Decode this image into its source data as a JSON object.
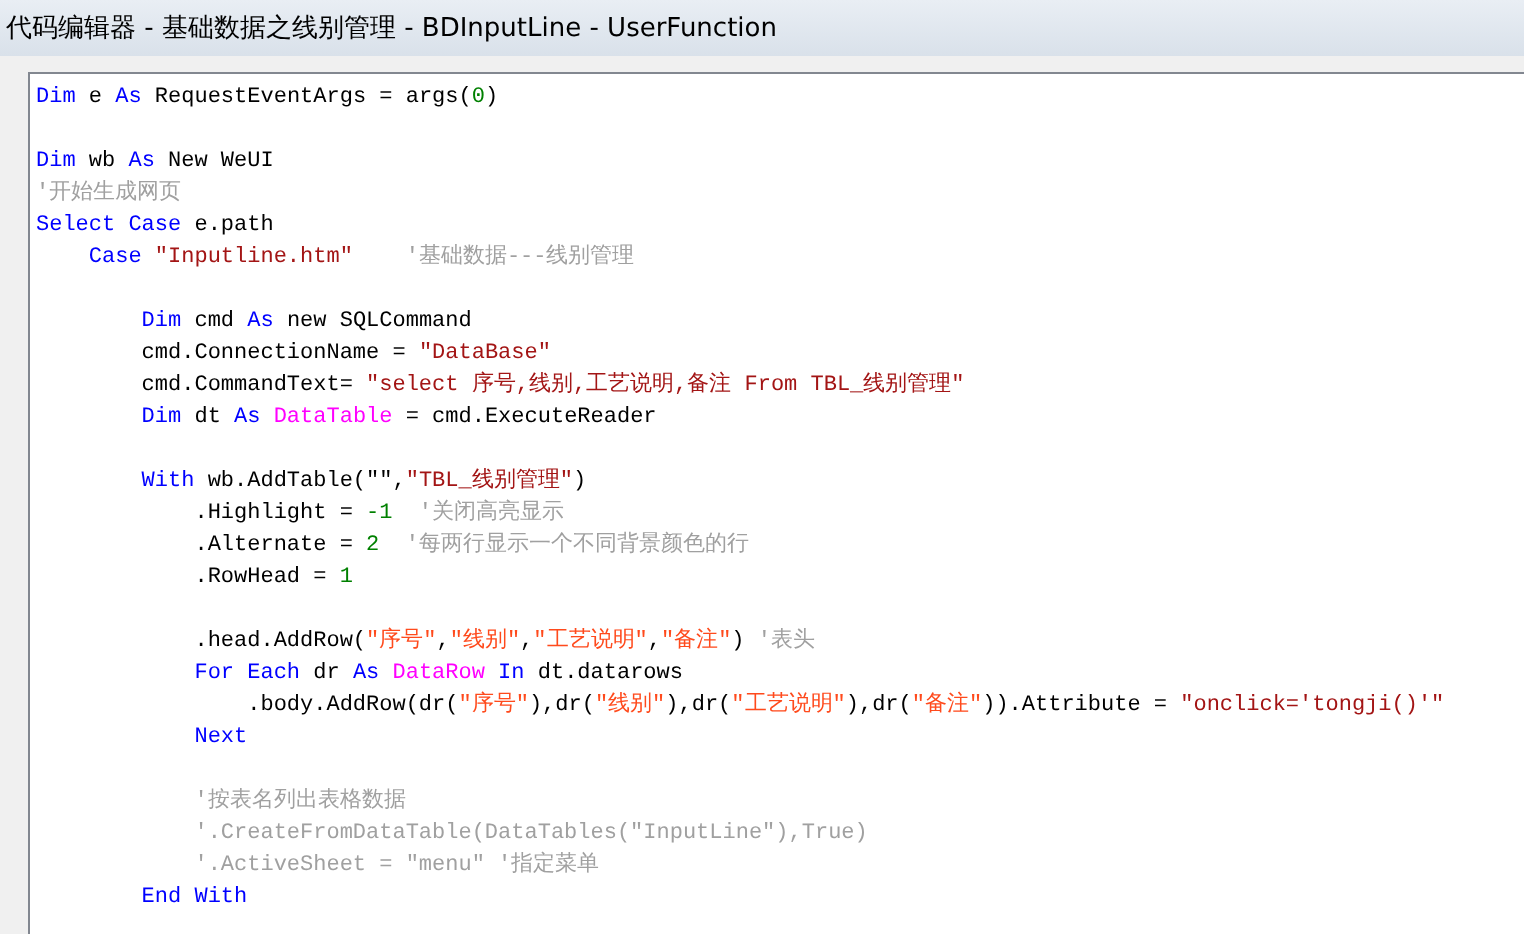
{
  "window": {
    "title": "代码编辑器 - 基础数据之线别管理 - BDInputLine - UserFunction"
  },
  "editor": {
    "lines": [
      {
        "kind": "code",
        "tokens": [
          {
            "kind": "keyword",
            "text": "Dim"
          },
          {
            "kind": "plain",
            "text": " e "
          },
          {
            "kind": "keyword",
            "text": "As"
          },
          {
            "kind": "plain",
            "text": " RequestEventArgs = args("
          },
          {
            "kind": "number",
            "text": "0"
          },
          {
            "kind": "plain",
            "text": ")"
          }
        ]
      },
      {
        "kind": "blank"
      },
      {
        "kind": "code",
        "tokens": [
          {
            "kind": "keyword",
            "text": "Dim"
          },
          {
            "kind": "plain",
            "text": " wb "
          },
          {
            "kind": "keyword",
            "text": "As"
          },
          {
            "kind": "plain",
            "text": " New WeUI"
          }
        ]
      },
      {
        "kind": "code",
        "tokens": [
          {
            "kind": "comment",
            "text": "'开始生成网页"
          }
        ]
      },
      {
        "kind": "code",
        "tokens": [
          {
            "kind": "keyword",
            "text": "Select Case"
          },
          {
            "kind": "plain",
            "text": " e.path"
          }
        ]
      },
      {
        "kind": "code",
        "tokens": [
          {
            "kind": "keyword",
            "text": "    Case"
          },
          {
            "kind": "string",
            "text": " \"Inputline.htm\""
          },
          {
            "kind": "comment",
            "text": "    '基础数据---线别管理"
          }
        ]
      },
      {
        "kind": "blank"
      },
      {
        "kind": "code",
        "tokens": [
          {
            "kind": "keyword",
            "text": "        Dim"
          },
          {
            "kind": "plain",
            "text": " cmd "
          },
          {
            "kind": "keyword",
            "text": "As"
          },
          {
            "kind": "plain",
            "text": " new SQLCommand"
          }
        ]
      },
      {
        "kind": "code",
        "tokens": [
          {
            "kind": "plain",
            "text": "        cmd.ConnectionName = "
          },
          {
            "kind": "string",
            "text": "\"DataBase\""
          }
        ]
      },
      {
        "kind": "code",
        "tokens": [
          {
            "kind": "plain",
            "text": "        cmd.CommandText= "
          },
          {
            "kind": "string",
            "text": "\"select 序号,线别,工艺说明,备注 From TBL_线别管理\""
          }
        ]
      },
      {
        "kind": "code",
        "tokens": [
          {
            "kind": "keyword",
            "text": "        Dim"
          },
          {
            "kind": "plain",
            "text": " dt "
          },
          {
            "kind": "keyword",
            "text": "As"
          },
          {
            "kind": "type",
            "text": " DataTable"
          },
          {
            "kind": "plain",
            "text": " = cmd.ExecuteReader"
          }
        ]
      },
      {
        "kind": "blank"
      },
      {
        "kind": "code",
        "tokens": [
          {
            "kind": "keyword",
            "text": "        With"
          },
          {
            "kind": "plain",
            "text": " wb.AddTable(\"\","
          },
          {
            "kind": "string",
            "text": "\"TBL_线别管理\""
          },
          {
            "kind": "plain",
            "text": ")"
          }
        ]
      },
      {
        "kind": "code",
        "tokens": [
          {
            "kind": "plain",
            "text": "            .Highlight = "
          },
          {
            "kind": "number",
            "text": "-1"
          },
          {
            "kind": "comment",
            "text": "  '关闭高亮显示"
          }
        ]
      },
      {
        "kind": "code",
        "tokens": [
          {
            "kind": "plain",
            "text": "            .Alternate = "
          },
          {
            "kind": "number",
            "text": "2"
          },
          {
            "kind": "comment",
            "text": "  '每两行显示一个不同背景颜色的行"
          }
        ]
      },
      {
        "kind": "code",
        "tokens": [
          {
            "kind": "plain",
            "text": "            .RowHead = "
          },
          {
            "kind": "number",
            "text": "1"
          }
        ]
      },
      {
        "kind": "blank"
      },
      {
        "kind": "code",
        "tokens": [
          {
            "kind": "plain",
            "text": "            .head.AddRow("
          },
          {
            "kind": "field",
            "text": "\"序号\""
          },
          {
            "kind": "plain",
            "text": ","
          },
          {
            "kind": "field",
            "text": "\"线别\""
          },
          {
            "kind": "plain",
            "text": ","
          },
          {
            "kind": "field",
            "text": "\"工艺说明\""
          },
          {
            "kind": "plain",
            "text": ","
          },
          {
            "kind": "field",
            "text": "\"备注\""
          },
          {
            "kind": "plain",
            "text": ")"
          },
          {
            "kind": "comment",
            "text": " '表头"
          }
        ]
      },
      {
        "kind": "code",
        "tokens": [
          {
            "kind": "keyword",
            "text": "            For Each"
          },
          {
            "kind": "plain",
            "text": " dr "
          },
          {
            "kind": "keyword",
            "text": "As"
          },
          {
            "kind": "type",
            "text": " DataRow"
          },
          {
            "kind": "keyword",
            "text": " In"
          },
          {
            "kind": "plain",
            "text": " dt.datarows"
          }
        ]
      },
      {
        "kind": "code",
        "tokens": [
          {
            "kind": "plain",
            "text": "                .body.AddRow(dr("
          },
          {
            "kind": "field",
            "text": "\"序号\""
          },
          {
            "kind": "plain",
            "text": "),dr("
          },
          {
            "kind": "field",
            "text": "\"线别\""
          },
          {
            "kind": "plain",
            "text": "),dr("
          },
          {
            "kind": "field",
            "text": "\"工艺说明\""
          },
          {
            "kind": "plain",
            "text": "),dr("
          },
          {
            "kind": "field",
            "text": "\"备注\""
          },
          {
            "kind": "plain",
            "text": ")).Attribute = "
          },
          {
            "kind": "string",
            "text": "\"onclick='tongji()'\""
          }
        ]
      },
      {
        "kind": "code",
        "tokens": [
          {
            "kind": "keyword",
            "text": "            Next"
          }
        ]
      },
      {
        "kind": "blank"
      },
      {
        "kind": "code",
        "tokens": [
          {
            "kind": "comment",
            "text": "            '按表名列出表格数据"
          }
        ]
      },
      {
        "kind": "code",
        "tokens": [
          {
            "kind": "comment",
            "text": "            '.CreateFromDataTable(DataTables(\"InputLine\"),True)"
          }
        ]
      },
      {
        "kind": "code",
        "tokens": [
          {
            "kind": "comment",
            "text": "            '.ActiveSheet = \"menu\" '指定菜单"
          }
        ]
      },
      {
        "kind": "code",
        "tokens": [
          {
            "kind": "keyword",
            "text": "        End With"
          }
        ]
      }
    ]
  }
}
